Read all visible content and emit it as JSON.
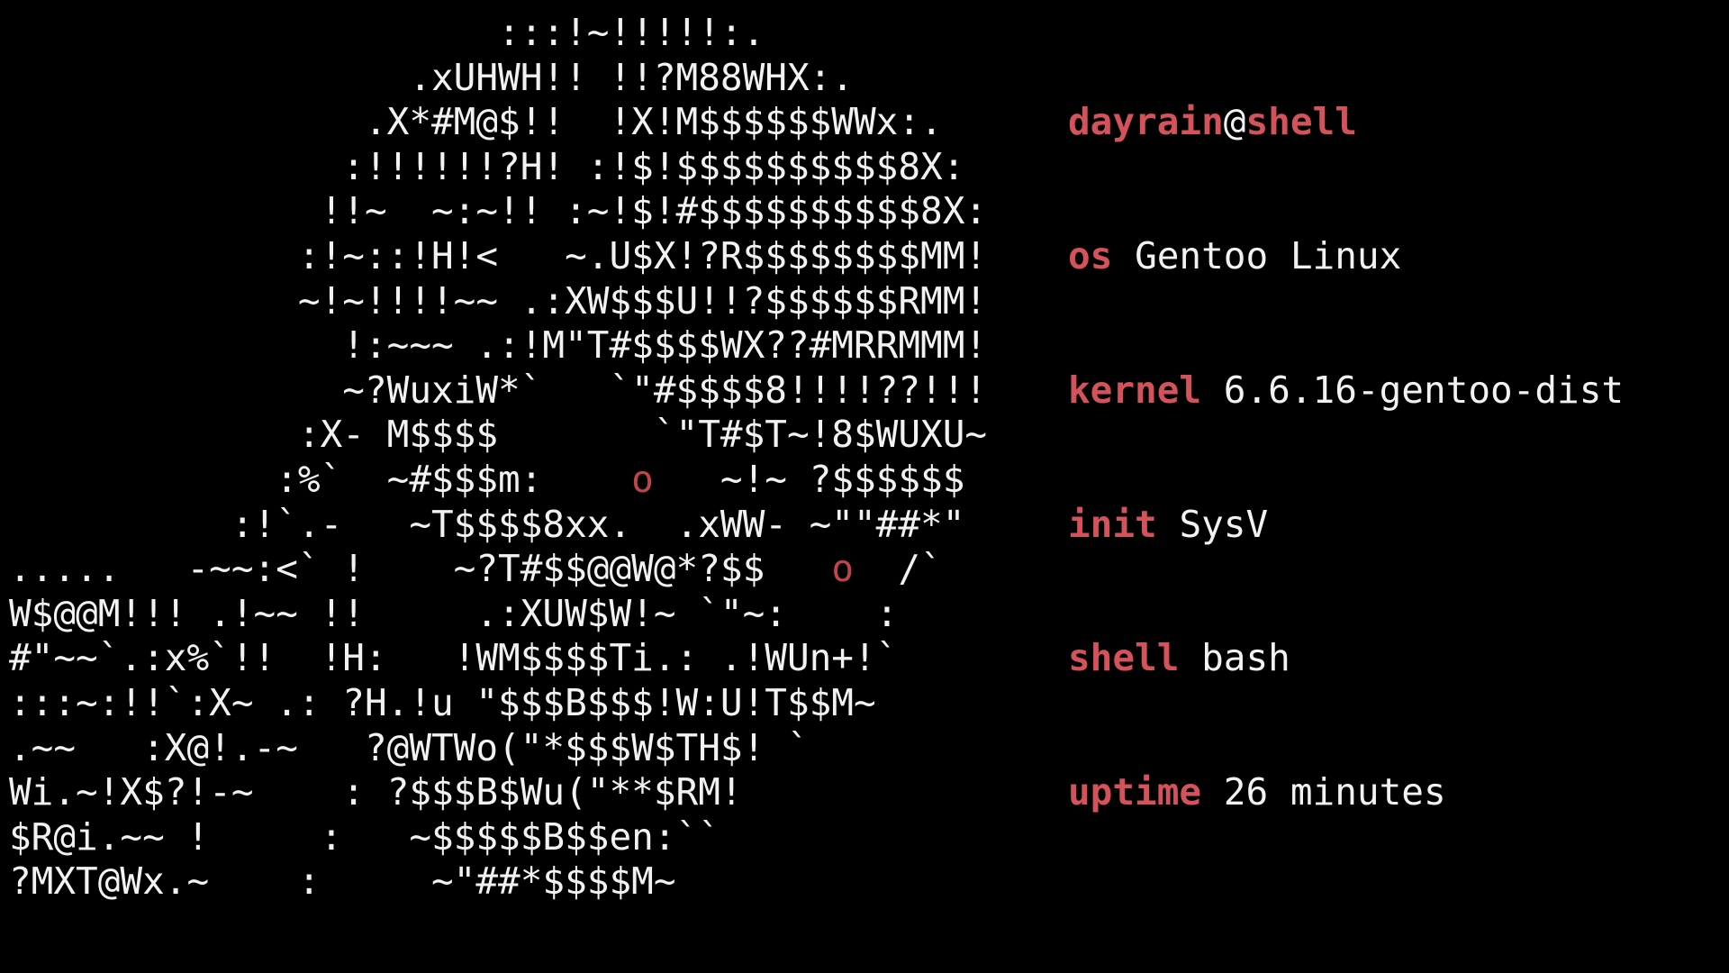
{
  "colors": {
    "background": "#000000",
    "foreground": "#f2f2f2",
    "accent": "#d4525a",
    "eye": "#c0444c"
  },
  "ascii_art": {
    "line_0": "                      :::!~!!!!!:.",
    "line_1": "                  .xUHWH!! !!?M88WHX:.",
    "line_2": "                .X*#M@$!!  !X!M$$$$$$WWx:.",
    "line_3": "               :!!!!!!?H! :!$!$$$$$$$$$$8X:",
    "line_4": "              !!~  ~:~!! :~!$!#$$$$$$$$$$8X:",
    "line_5": "             :!~::!H!<   ~.U$X!?R$$$$$$$$MM!",
    "line_6": "             ~!~!!!!~~ .:XW$$$U!!?$$$$$$RMM!",
    "line_7": "               !:~~~ .:!M\"T#$$$$WX??#MRRMMM!",
    "line_8": "               ~?WuxiW*`   `\"#$$$$8!!!!??!!!",
    "line_9a": "             :X- M$$$$       `\"T#$T~!8$WUXU~",
    "line_10a": "            :%`  ~#$$$m:    ",
    "eye_1": "o",
    "line_10b": "   ~!~ ?$$$$$$",
    "line_11": "          :!`.-   ~T$$$$8xx.  .xWW- ~\"\"##*\"",
    "line_12a": ".....   -~~:<` !    ~?T#$$@@W@*?$$   ",
    "eye_2": "o",
    "line_12b": "  /`",
    "line_13": "W$@@M!!! .!~~ !!     .:XUW$W!~ `\"~:    :",
    "line_14": "#\"~~`.:x%`!!  !H:   !WM$$$$Ti.: .!WUn+!`",
    "line_15": ":::~:!!`:X~ .: ?H.!u \"$$$B$$$!W:U!T$$M~",
    "line_16": ".~~   :X@!.-~   ?@WTWo(\"*$$$W$TH$! `",
    "line_17": "Wi.~!X$?!-~    : ?$$$B$Wu(\"**$RM!",
    "line_18": "$R@i.~~ !     :   ~$$$$$B$$en:``",
    "line_19": "?MXT@Wx.~    :     ~\"##*$$$$M~"
  },
  "sysinfo": {
    "user": "dayrain",
    "at": "@",
    "host": "shell",
    "os_key": "os",
    "os_val": "Gentoo Linux",
    "kernel_key": "kernel",
    "kernel_val": "6.6.16-gentoo-dist",
    "init_key": "init",
    "init_val": "SysV",
    "shell_key": "shell",
    "shell_val": "bash",
    "uptime_key": "uptime",
    "uptime_val": "26 minutes"
  }
}
